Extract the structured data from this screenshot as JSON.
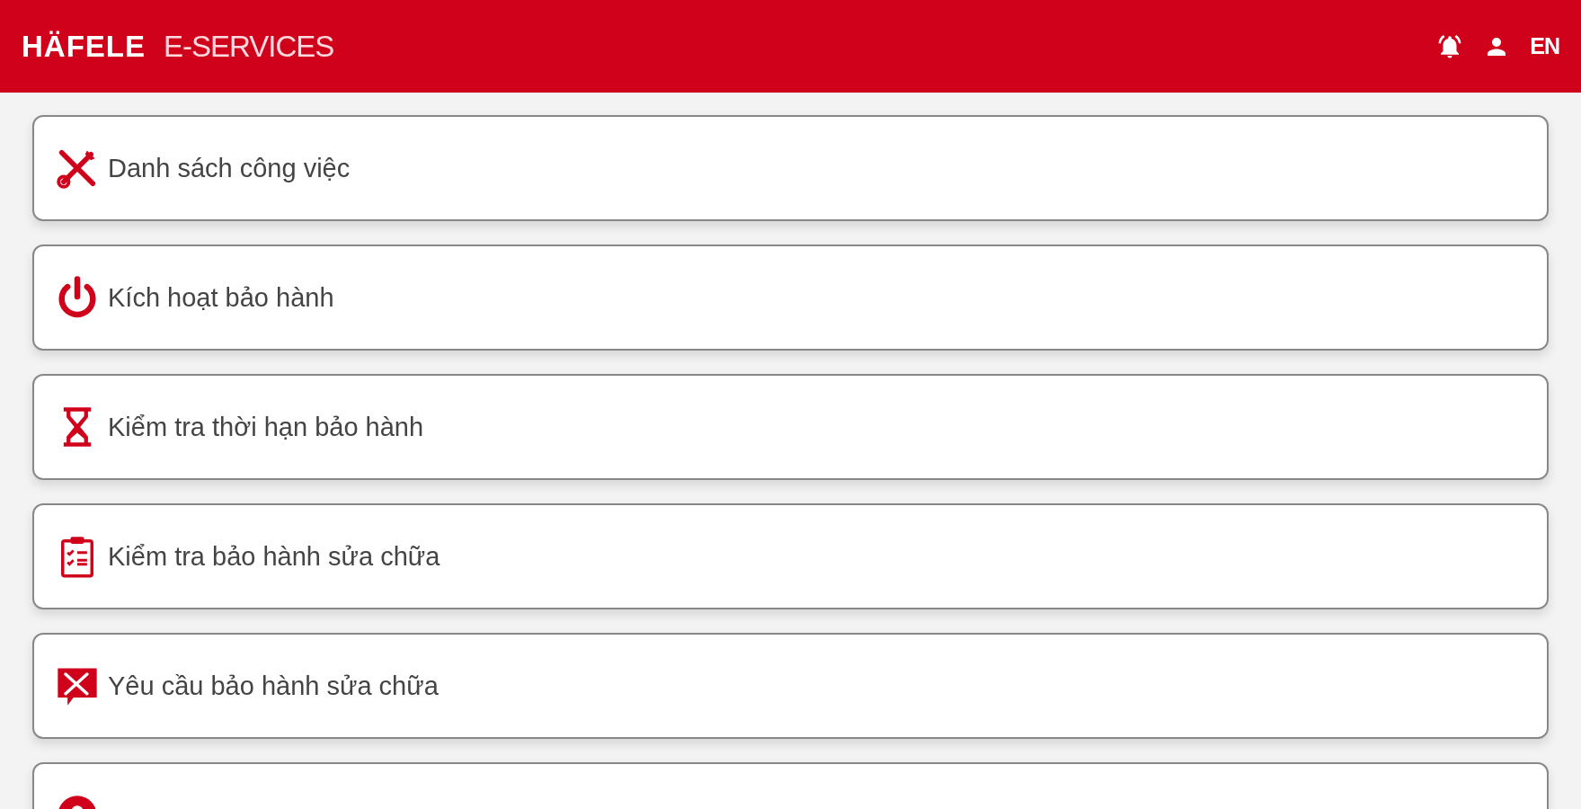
{
  "header": {
    "brand": "HÄFELE",
    "product": "E-SERVICES",
    "language": "EN"
  },
  "menu": [
    {
      "kind": "tools",
      "label": "Danh sách công việc"
    },
    {
      "kind": "power",
      "label": "Kích hoạt bảo hành"
    },
    {
      "kind": "hourglass",
      "label": "Kiểm tra thời hạn bảo hành"
    },
    {
      "kind": "clipboard",
      "label": "Kiểm tra bảo hành sửa chữa"
    },
    {
      "kind": "request",
      "label": "Yêu cầu bảo hành sửa chữa"
    },
    {
      "kind": "pin"
    }
  ]
}
